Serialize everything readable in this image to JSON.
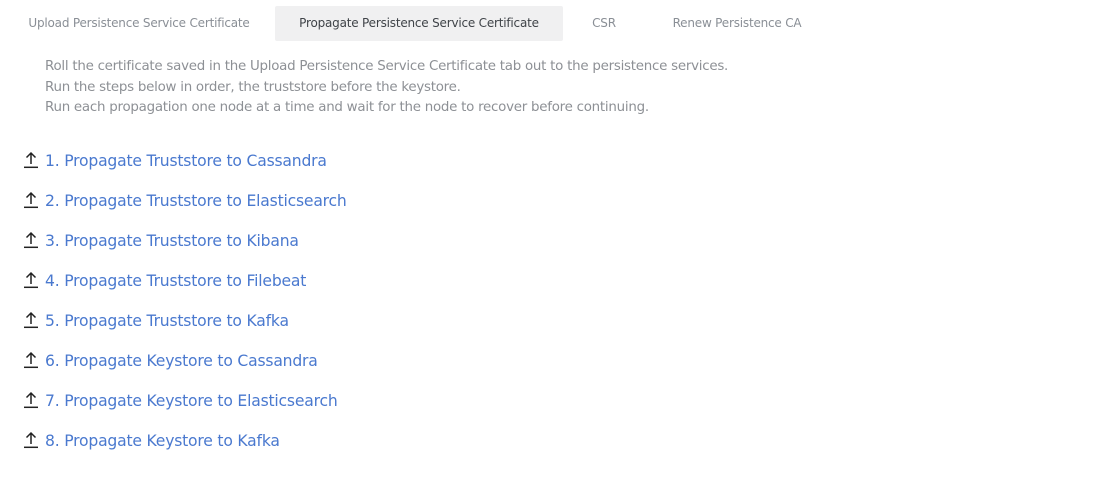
{
  "tabs": [
    {
      "label": "Upload Persistence Service Certificate",
      "active": false
    },
    {
      "label": "Propagate Persistence Service Certificate",
      "active": true
    },
    {
      "label": "CSR",
      "active": false
    },
    {
      "label": "Renew Persistence CA",
      "active": false
    }
  ],
  "description": [
    "Roll the certificate saved in the Upload Persistence Service Certificate tab out to the persistence services.",
    "Run the steps below in order, the truststore before the keystore.",
    "Run each propagation one node at a time and wait for the node to recover before continuing."
  ],
  "steps": [
    {
      "label": "1. Propagate Truststore to Cassandra",
      "icon": "upload-icon"
    },
    {
      "label": "2. Propagate Truststore to Elasticsearch",
      "icon": "upload-icon"
    },
    {
      "label": "3. Propagate Truststore to Kibana",
      "icon": "upload-icon"
    },
    {
      "label": "4. Propagate Truststore to Filebeat",
      "icon": "upload-icon"
    },
    {
      "label": "5. Propagate Truststore to Kafka",
      "icon": "upload-icon"
    },
    {
      "label": "6. Propagate Keystore to Cassandra",
      "icon": "upload-icon"
    },
    {
      "label": "7. Propagate Keystore to Elasticsearch",
      "icon": "upload-icon"
    },
    {
      "label": "8. Propagate Keystore to Kafka",
      "icon": "upload-icon"
    }
  ],
  "colors": {
    "link": "#4a79cf",
    "active_tab_bg": "#f0f0f1",
    "muted_text": "#8d9095"
  }
}
